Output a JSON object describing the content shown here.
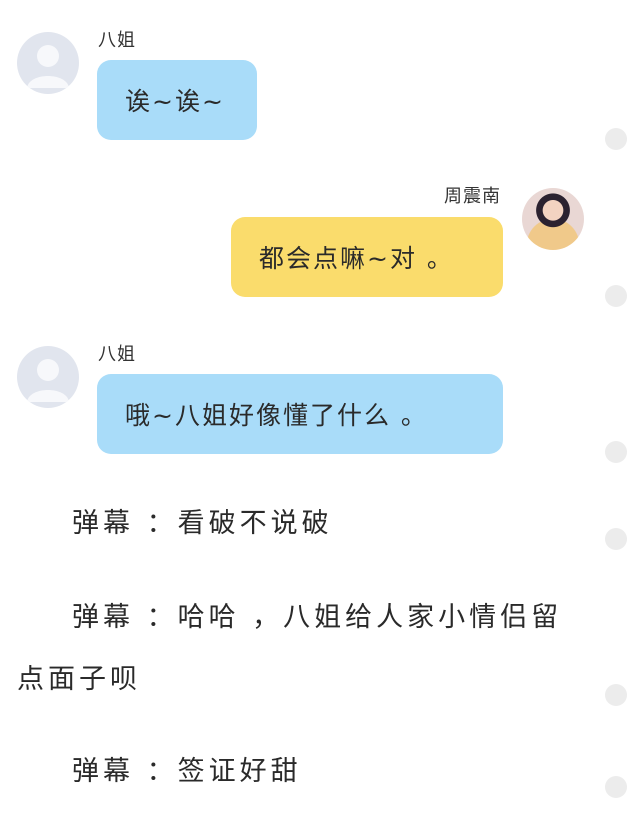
{
  "messages": [
    {
      "sender": "八姐",
      "text": "诶~诶~",
      "side": "left",
      "color": "#a9dcf9"
    },
    {
      "sender": "周震南",
      "text": "都会点嘛~对 。",
      "side": "right",
      "color": "#fadc6c"
    },
    {
      "sender": "八姐",
      "text": "哦~八姐好像懂了什么 。",
      "side": "left",
      "color": "#a9dcf9"
    }
  ],
  "danmaku": [
    {
      "line1": "弹幕 ：看破不说破",
      "line2": ""
    },
    {
      "line1": "弹幕 ：哈哈 ，八姐给人家小情侣留",
      "line2": "点面子呗"
    },
    {
      "line1": "弹幕 ：签证好甜",
      "line2": ""
    }
  ]
}
